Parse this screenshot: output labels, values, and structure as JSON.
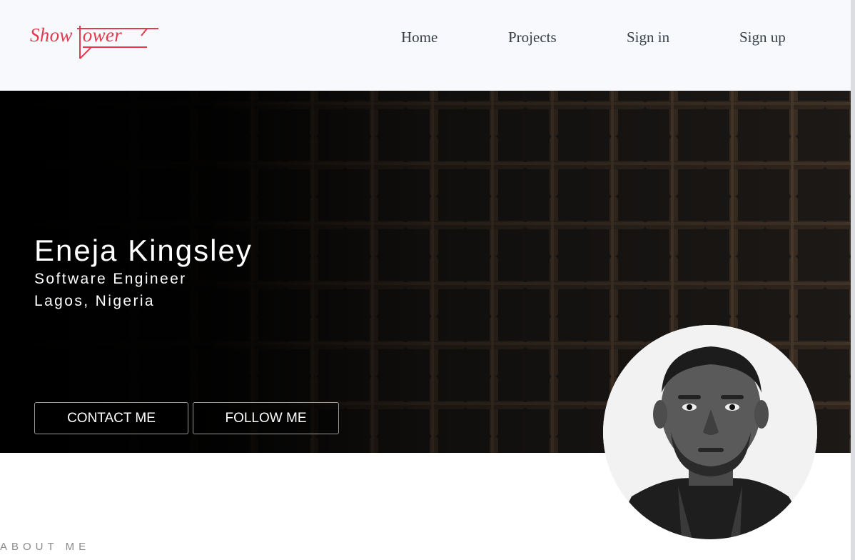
{
  "brand": {
    "logo_text": "Showtower",
    "accent_color": "#e23a4f"
  },
  "nav": {
    "home": "Home",
    "projects": "Projects",
    "sign_in": "Sign in",
    "sign_up": "Sign up"
  },
  "hero": {
    "name": "Eneja Kingsley",
    "title": "Software Engineer",
    "location": "Lagos, Nigeria",
    "contact_label": "CONTACT ME",
    "follow_label": "FOLLOW ME"
  },
  "about": {
    "heading": "ABOUT ME"
  }
}
